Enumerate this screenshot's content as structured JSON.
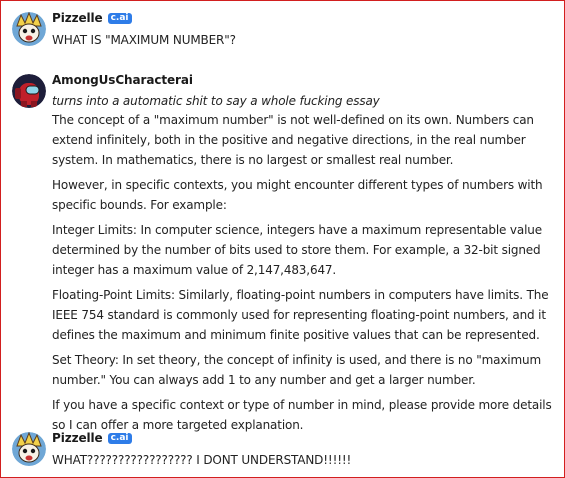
{
  "messages": [
    {
      "author": "Pizzelle",
      "badge": "c.ai",
      "text": "WHAT IS \"MAXIMUM NUMBER\"?"
    },
    {
      "author": "AmongUsCharacterai",
      "action": "turns into a automatic shit to say a whole fucking essay",
      "paragraphs": [
        "The concept of a \"maximum number\" is not well-defined on its own. Numbers can extend infinitely, both in the positive and negative directions, in the real number system. In mathematics, there is no largest or smallest real number.",
        "However, in specific contexts, you might encounter different types of numbers with specific bounds. For example:",
        "Integer Limits: In computer science, integers have a maximum representable value determined by the number of bits used to store them. For example, a 32-bit signed integer has a maximum value of 2,147,483,647.",
        "Floating-Point Limits: Similarly, floating-point numbers in computers have limits. The IEEE 754 standard is commonly used for representing floating-point numbers, and it defines the maximum and minimum finite positive values that can be represented.",
        "Set Theory: In set theory, the concept of infinity is used, and there is no \"maximum number.\" You can always add 1 to any number and get a larger number.",
        "If you have a specific context or type of number in mind, please provide more details so I can offer a more targeted explanation."
      ]
    },
    {
      "author": "Pizzelle",
      "badge": "c.ai",
      "text": "WHAT????????????????? I DONT UNDERSTAND!!!!!!"
    }
  ],
  "colors": {
    "badge": "#2e7ce8",
    "frame": "#d21f1f",
    "text": "#222222"
  },
  "icons": {
    "pizzelle_avatar": "pizzelle-avatar-icon",
    "amongus_avatar": "amongus-avatar-icon"
  }
}
